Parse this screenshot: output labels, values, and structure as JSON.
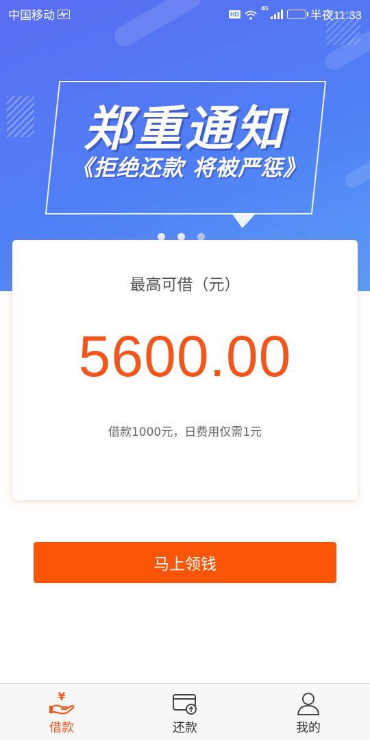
{
  "status_bar": {
    "carrier": "中国移动",
    "network": "4G",
    "time": "半夜11:33"
  },
  "banner": {
    "title": "郑重通知",
    "subtitle": "《拒绝还款 将被严惩》",
    "slide_count": 3,
    "active_slide": 1
  },
  "loan_card": {
    "label": "最高可借（元）",
    "amount": "5600.00",
    "description": "借款1000元，日费用仅需1元"
  },
  "cta": {
    "label": "马上领钱"
  },
  "tab_bar": {
    "items": [
      {
        "label": "借款",
        "icon": "yen-hand-icon",
        "active": true
      },
      {
        "label": "还款",
        "icon": "card-repay-icon",
        "active": false
      },
      {
        "label": "我的",
        "icon": "person-icon",
        "active": false
      }
    ]
  },
  "colors": {
    "accent": "#f2561d",
    "button": "#fb5508",
    "banner_blue": "#4f7ff5"
  }
}
